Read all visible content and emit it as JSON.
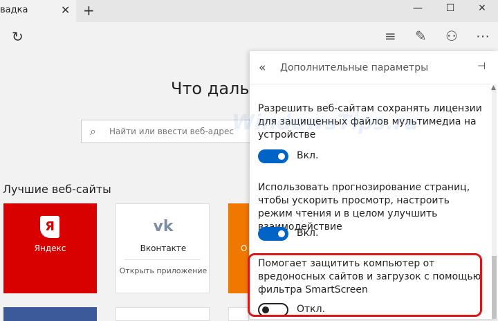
{
  "tab": {
    "title": "вадка",
    "close_icon": "✕"
  },
  "titlebar": {
    "new_tab_icon": "+",
    "minimize_icon": "—",
    "maximize_icon": "☐",
    "close_icon": "✕"
  },
  "toolbar": {
    "refresh_icon": "↻",
    "hub_icon": "≡",
    "note_icon": "✎",
    "share_icon": "⚇",
    "more_icon": "⋯"
  },
  "page": {
    "heading": "Что дальш",
    "search_placeholder": "Найти или ввести веб-адрес",
    "search_icon": "⌕",
    "top_sites_title": "Лучшие веб-сайты",
    "tiles": [
      {
        "logo": "Я",
        "label": "Яндекс",
        "color": "#d90000"
      },
      {
        "logo": "vk",
        "label": "Вконтакте",
        "action": "Открыть приложение",
        "color": "#ffffff"
      },
      {
        "label": "О",
        "color": "#f07800"
      }
    ]
  },
  "panel": {
    "back_icon": "«",
    "title": "Дополнительные параметры",
    "pin_icon": "⊣",
    "settings": [
      {
        "text": "Разрешить веб-сайтам сохранять лицензии для защищенных файлов мультимедиа на устройстве",
        "state_label": "Вкл.",
        "on": true
      },
      {
        "text": "Использовать прогнозирование страниц, чтобы ускорить просмотр, настроить режим чтения и в целом улучшить взаимодействие",
        "state_label": "Вкл.",
        "on": true
      },
      {
        "text": "Помогает защитить компьютер от вредоносных сайтов и загрузок с помощью фильтра SmartScreen",
        "state_label": "Откл.",
        "on": false
      }
    ]
  },
  "watermark": "WindowsTips.ru",
  "colors": {
    "accent": "#0063c8",
    "highlight": "#d81818",
    "yandex": "#d90000",
    "orange": "#f07800"
  }
}
